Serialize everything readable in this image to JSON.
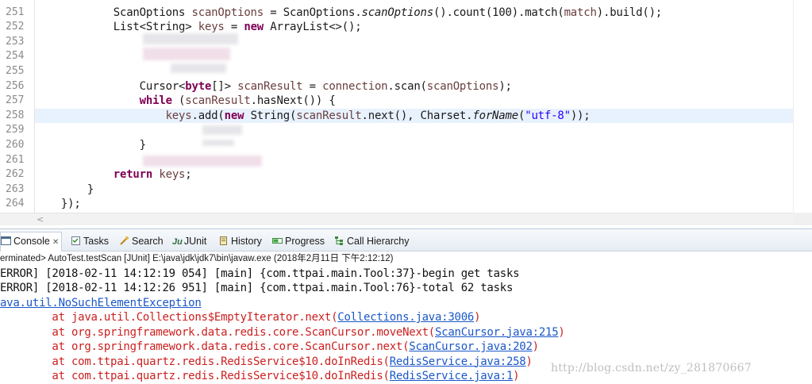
{
  "editor": {
    "line_numbers": [
      "251",
      "252",
      "253",
      "254",
      "255",
      "256",
      "257",
      "258",
      "259",
      "260",
      "261",
      "262",
      "263",
      "264"
    ],
    "lines": [
      {
        "indent": "            ",
        "tokens": [
          {
            "t": "ScanOptions ",
            "c": ""
          },
          {
            "t": "scanOptions",
            "c": "var"
          },
          {
            "t": " = ScanOptions.",
            "c": ""
          },
          {
            "t": "scanOptions",
            "c": "ital"
          },
          {
            "t": "().count(100).match(",
            "c": ""
          },
          {
            "t": "match",
            "c": "var"
          },
          {
            "t": ").build();",
            "c": ""
          }
        ]
      },
      {
        "indent": "            ",
        "tokens": [
          {
            "t": "List<String> ",
            "c": ""
          },
          {
            "t": "keys",
            "c": "var"
          },
          {
            "t": " = ",
            "c": ""
          },
          {
            "t": "new",
            "c": "kw"
          },
          {
            "t": " ArrayList<>();",
            "c": ""
          }
        ]
      },
      {
        "indent": "",
        "tokens": []
      },
      {
        "indent": "",
        "tokens": []
      },
      {
        "indent": "",
        "tokens": []
      },
      {
        "indent": "                ",
        "tokens": [
          {
            "t": "Cursor<",
            "c": ""
          },
          {
            "t": "byte",
            "c": "kw"
          },
          {
            "t": "[]> ",
            "c": ""
          },
          {
            "t": "scanResult",
            "c": "var"
          },
          {
            "t": " = ",
            "c": ""
          },
          {
            "t": "connection",
            "c": "var"
          },
          {
            "t": ".scan(",
            "c": ""
          },
          {
            "t": "scanOptions",
            "c": "var"
          },
          {
            "t": ");",
            "c": ""
          }
        ]
      },
      {
        "indent": "                ",
        "tokens": [
          {
            "t": "while",
            "c": "kw"
          },
          {
            "t": " (",
            "c": ""
          },
          {
            "t": "scanResult",
            "c": "var"
          },
          {
            "t": ".hasNext()) {",
            "c": ""
          }
        ]
      },
      {
        "indent": "                    ",
        "tokens": [
          {
            "t": "keys",
            "c": "var"
          },
          {
            "t": ".add(",
            "c": ""
          },
          {
            "t": "new",
            "c": "kw"
          },
          {
            "t": " String(",
            "c": ""
          },
          {
            "t": "scanResult",
            "c": "var"
          },
          {
            "t": ".next(), Charset.",
            "c": ""
          },
          {
            "t": "forName",
            "c": "ital"
          },
          {
            "t": "(",
            "c": ""
          },
          {
            "t": "\"utf-8\"",
            "c": "str"
          },
          {
            "t": "));",
            "c": ""
          }
        ]
      },
      {
        "indent": "",
        "tokens": []
      },
      {
        "indent": "                ",
        "tokens": [
          {
            "t": "}",
            "c": ""
          }
        ]
      },
      {
        "indent": "",
        "tokens": []
      },
      {
        "indent": "            ",
        "tokens": [
          {
            "t": "return",
            "c": "kw"
          },
          {
            "t": " ",
            "c": ""
          },
          {
            "t": "keys",
            "c": "var"
          },
          {
            "t": ";",
            "c": ""
          }
        ]
      },
      {
        "indent": "        ",
        "tokens": [
          {
            "t": "}",
            "c": ""
          }
        ]
      },
      {
        "indent": "    ",
        "tokens": [
          {
            "t": "});",
            "c": ""
          }
        ]
      }
    ],
    "current_line_index": 7,
    "hscroll_arrow": "<"
  },
  "console": {
    "tabs": [
      {
        "label": "Console",
        "icon": "console-icon",
        "active": true,
        "closable": true
      },
      {
        "label": "Tasks",
        "icon": "tasks-icon"
      },
      {
        "label": "Search",
        "icon": "search-icon"
      },
      {
        "label": "JUnit",
        "icon": "junit-icon",
        "prefix": "Ju"
      },
      {
        "label": "History",
        "icon": "history-icon"
      },
      {
        "label": "Progress",
        "icon": "progress-icon"
      },
      {
        "label": "Call Hierarchy",
        "icon": "call-hierarchy-icon"
      }
    ],
    "close_glyph": "✕",
    "status": "erminated> AutoTest.testScan [JUnit] E:\\java\\jdk\\jdk7\\bin\\javaw.exe (2018年2月11日 下午2:12:12)",
    "output": [
      {
        "kind": "plain",
        "parts": [
          {
            "t": "ERROR] [2018-02-11 14:12:19 054] [main] {com.ttpai.main.Tool:37}-begin get tasks"
          }
        ]
      },
      {
        "kind": "plain",
        "parts": [
          {
            "t": "ERROR] [2018-02-11 14:12:26 951] [main] {com.ttpai.main.Tool:76}-total 62 tasks"
          }
        ]
      },
      {
        "kind": "link",
        "parts": [
          {
            "t": "ava.util.NoSuchElementException",
            "link": true
          }
        ]
      },
      {
        "kind": "err",
        "parts": [
          {
            "t": "        at java.util.Collections$EmptyIterator.next("
          },
          {
            "t": "Collections.java:3006",
            "link": true
          },
          {
            "t": ")"
          }
        ]
      },
      {
        "kind": "err",
        "parts": [
          {
            "t": "        at org.springframework.data.redis.core.ScanCursor.moveNext("
          },
          {
            "t": "ScanCursor.java:215",
            "link": true
          },
          {
            "t": ")"
          }
        ]
      },
      {
        "kind": "err",
        "parts": [
          {
            "t": "        at org.springframework.data.redis.core.ScanCursor.next("
          },
          {
            "t": "ScanCursor.java:202",
            "link": true
          },
          {
            "t": ")"
          }
        ]
      },
      {
        "kind": "err",
        "parts": [
          {
            "t": "        at com.ttpai.quartz.redis.RedisService$10.doInRedis("
          },
          {
            "t": "RedisService.java:258",
            "link": true
          },
          {
            "t": ")"
          }
        ]
      },
      {
        "kind": "err",
        "parts": [
          {
            "t": "        at com.ttpai.quartz.redis.RedisService$10.doInRedis("
          },
          {
            "t": "RedisService.java:1",
            "link": true
          },
          {
            "t": ")"
          }
        ]
      }
    ],
    "watermark": "http://blog.csdn.net/zy_281870667"
  },
  "colors": {
    "keyword": "#7f0055",
    "local_variable": "#6a3e3e",
    "string": "#2a00ff",
    "error_text": "#cc1f1f",
    "link": "#1a57c8",
    "current_line": "#e8f2fe"
  }
}
